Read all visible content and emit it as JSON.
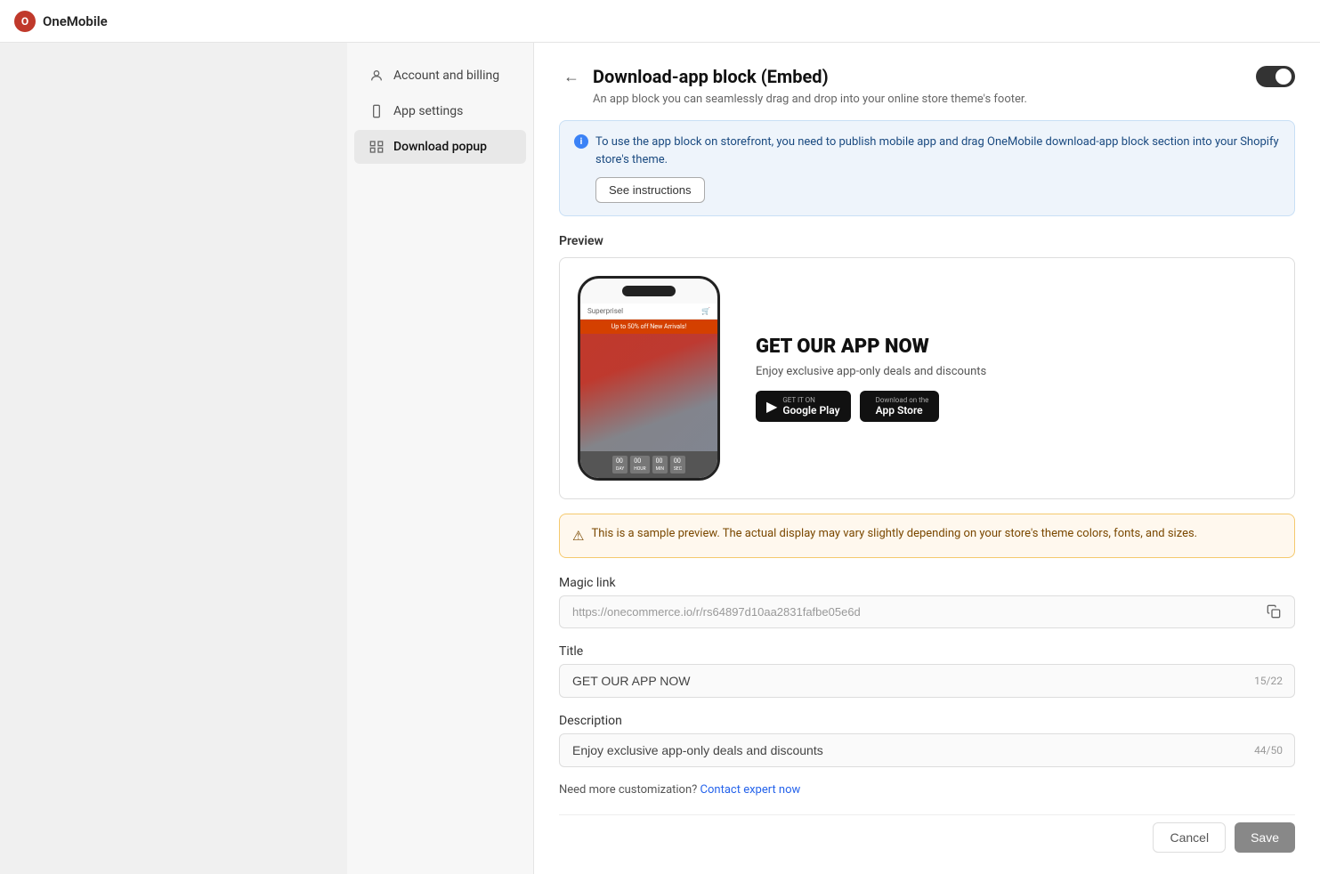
{
  "app": {
    "name": "OneMobile"
  },
  "topbar": {
    "logo_label": "OneMobile"
  },
  "sidebar": {
    "items": [
      {
        "id": "account-billing",
        "label": "Account and billing",
        "icon": "user"
      },
      {
        "id": "app-settings",
        "label": "App settings",
        "icon": "phone"
      },
      {
        "id": "download-popup",
        "label": "Download popup",
        "icon": "grid",
        "active": true
      }
    ]
  },
  "page": {
    "title": "Download-app block (Embed)",
    "subtitle": "An app block you can seamlessly drag and drop into your online store theme's footer.",
    "toggle_enabled": true
  },
  "info_banner": {
    "text": "To use the app block on storefront, you need to publish mobile app and drag OneMobile download-app block section into your Shopify store's theme.",
    "see_instructions_label": "See instructions"
  },
  "preview": {
    "label": "Preview",
    "phone": {
      "navbar_text": "Superprisel",
      "banner_text": "Up to 50% off New Arrivals!",
      "countdown_items": [
        "00 DAY",
        "00 HOUR",
        "00 MINUTE",
        "00 SECOND"
      ]
    },
    "promo": {
      "title": "GET OUR APP NOW",
      "description": "Enjoy exclusive app-only deals and discounts",
      "google_play_sub": "GET IT ON",
      "google_play_name": "Google Play",
      "app_store_sub": "Download on the",
      "app_store_name": "App Store"
    }
  },
  "warning_banner": {
    "text": "This is a sample preview. The actual display may vary slightly depending on your store's theme colors, fonts, and sizes."
  },
  "magic_link": {
    "label": "Magic link",
    "value": "https://onecommerce.io/r/rs64897d10aa2831fafbe05e6d"
  },
  "title_field": {
    "label": "Title",
    "value": "GET OUR APP NOW",
    "counter": "15/22"
  },
  "description_field": {
    "label": "Description",
    "value": "Enjoy exclusive app-only deals and discounts",
    "counter": "44/50"
  },
  "customization": {
    "text": "Need more customization?",
    "link_label": "Contact expert now"
  },
  "footer": {
    "cancel_label": "Cancel",
    "save_label": "Save"
  }
}
